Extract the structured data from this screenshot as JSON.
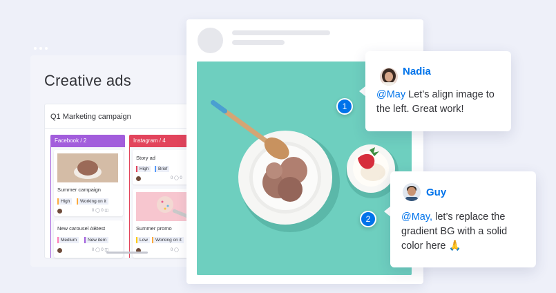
{
  "board": {
    "title": "Creative ads",
    "campaign": "Q1 Marketing campaign",
    "columns": [
      {
        "label": "Facebook / 2",
        "cards": [
          {
            "title": "Summer campaign",
            "tags": [
              "High",
              "Working on it"
            ],
            "meta": "0 ◯ 0 ◫"
          },
          {
            "title": "New carousel ABtest",
            "tags": [
              "Medium",
              "New item"
            ],
            "meta": "0 ◯ 0 ◫"
          }
        ]
      },
      {
        "label": "Instagram / 4",
        "cards": [
          {
            "title": "Story ad",
            "tags": [
              "High",
              "Brief"
            ],
            "meta": "0 ◯ 0"
          },
          {
            "title": "Summer promo",
            "tags": [
              "Low",
              "Working on it"
            ],
            "meta": "0 ◯"
          }
        ]
      }
    ]
  },
  "comments": [
    {
      "pin": "1",
      "author": "Nadia",
      "mention": "@May",
      "text": " Let’s align image to the left. Great work!"
    },
    {
      "pin": "2",
      "author": "Guy",
      "mention": "@May,",
      "text": " let’s replace the gradient BG with a solid color here 🙏"
    }
  ],
  "colors": {
    "accent": "#0073ea",
    "facebook_column": "#a25ddc",
    "instagram_column": "#e2445c",
    "photo_background": "#6ecfbf",
    "page_background": "#eef0f9"
  }
}
